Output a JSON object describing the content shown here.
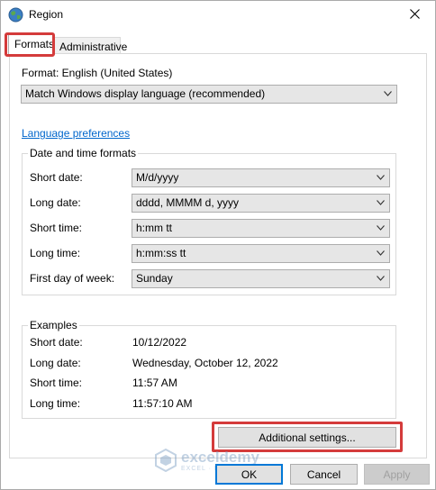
{
  "window": {
    "title": "Region"
  },
  "tabs": [
    {
      "label": "Formats",
      "active": true
    },
    {
      "label": "Administrative",
      "active": false
    }
  ],
  "format": {
    "label": "Format: English (United States)",
    "selected": "Match Windows display language (recommended)"
  },
  "language_link": "Language preferences",
  "date_time": {
    "title": "Date and time formats",
    "rows": [
      {
        "label": "Short date:",
        "value": "M/d/yyyy"
      },
      {
        "label": "Long date:",
        "value": "dddd, MMMM d, yyyy"
      },
      {
        "label": "Short time:",
        "value": "h:mm tt"
      },
      {
        "label": "Long time:",
        "value": "h:mm:ss tt"
      },
      {
        "label": "First day of week:",
        "value": "Sunday"
      }
    ]
  },
  "examples": {
    "title": "Examples",
    "rows": [
      {
        "label": "Short date:",
        "value": "10/12/2022"
      },
      {
        "label": "Long date:",
        "value": "Wednesday, October 12, 2022"
      },
      {
        "label": "Short time:",
        "value": "11:57 AM"
      },
      {
        "label": "Long time:",
        "value": "11:57:10 AM"
      }
    ]
  },
  "buttons": {
    "additional": "Additional settings...",
    "ok": "OK",
    "cancel": "Cancel",
    "apply": "Apply"
  },
  "watermark": {
    "brand": "exceldemy",
    "tagline": "EXCEL · DATA · BI"
  },
  "colors": {
    "highlight": "#d43b3b",
    "link": "#0066cc",
    "default_border": "#0078d7"
  }
}
